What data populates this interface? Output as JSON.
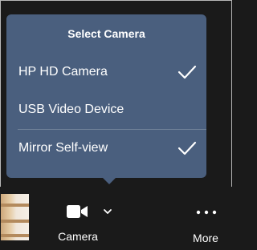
{
  "menu": {
    "title": "Select Camera",
    "items": [
      {
        "label": "HP HD Camera",
        "checked": true
      },
      {
        "label": "USB Video Device",
        "checked": false
      },
      {
        "label": "Mirror Self-view",
        "checked": true
      }
    ]
  },
  "toolbar": {
    "camera_label": "Camera",
    "more_label": "More",
    "camera_icon": "video-camera-icon",
    "caret_icon": "chevron-down-icon",
    "more_icon": "more-dots-icon"
  },
  "colors": {
    "menu_bg": "#4a5f7e",
    "toolbar_bg": "#1a1a1a",
    "text": "#ffffff"
  }
}
